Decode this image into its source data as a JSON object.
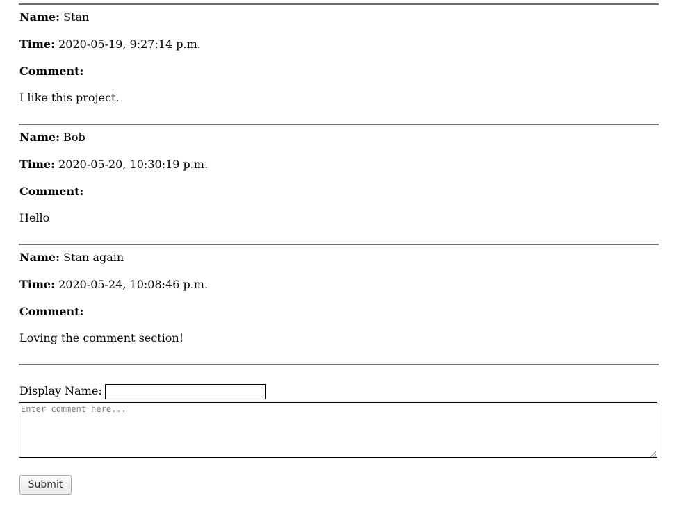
{
  "comments": [
    {
      "name_label": "Name:",
      "name": "Stan",
      "time_label": "Time:",
      "time": "2020-05-19, 9:27:14 p.m.",
      "comment_label": "Comment:",
      "comment": "I like this project."
    },
    {
      "name_label": "Name:",
      "name": "Bob",
      "time_label": "Time:",
      "time": "2020-05-20, 10:30:19 p.m.",
      "comment_label": "Comment:",
      "comment": "Hello"
    },
    {
      "name_label": "Name:",
      "name": "Stan again",
      "time_label": "Time:",
      "time": "2020-05-24, 10:08:46 p.m.",
      "comment_label": "Comment:",
      "comment": "Loving the comment section!"
    }
  ],
  "form": {
    "display_name_label": "Display Name:",
    "display_name_value": "",
    "comment_placeholder": "Enter comment here...",
    "submit_label": "Submit"
  }
}
